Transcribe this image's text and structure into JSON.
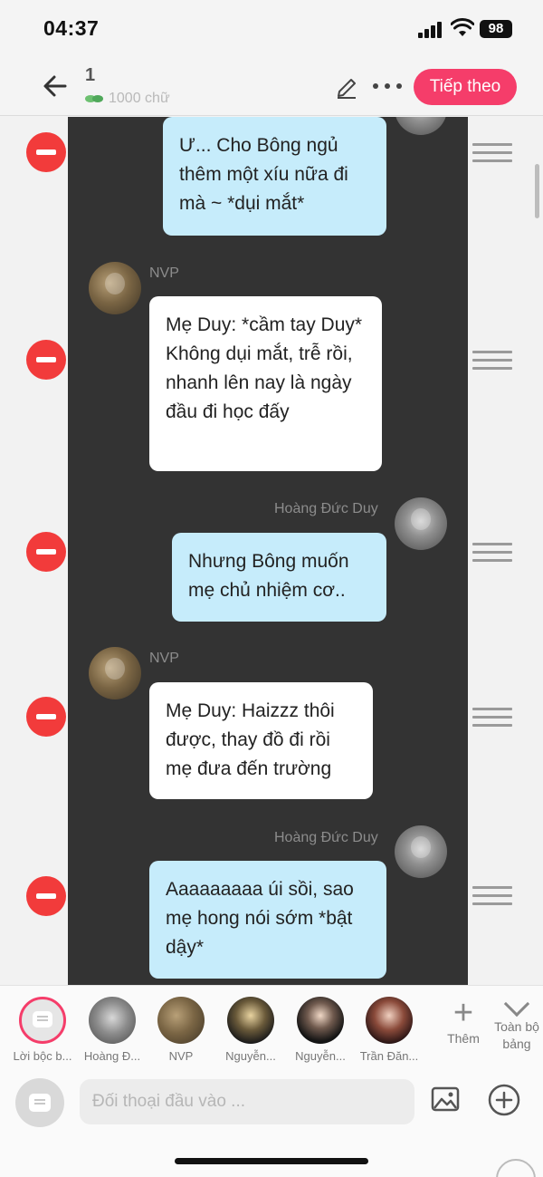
{
  "status_bar": {
    "time": "04:37",
    "battery": "98"
  },
  "header": {
    "title": "1",
    "word_count": "1000 chữ",
    "next_label": "Tiếp theo"
  },
  "messages": [
    {
      "speaker": "",
      "text": "Ư... Cho Bông ngủ thêm một xíu nữa đi mà ~ *dụi mắt*",
      "side": "right",
      "color": "blue"
    },
    {
      "speaker": "NVP",
      "text": "Mẹ Duy: *cầm tay Duy* Không dụi mắt, trễ rồi, nhanh lên nay là ngày đầu đi học đấy",
      "side": "left",
      "color": "white"
    },
    {
      "speaker": "Hoàng Đức Duy",
      "text": "Nhưng Bông muốn mẹ chủ nhiệm cơ..",
      "side": "right",
      "color": "blue"
    },
    {
      "speaker": "NVP",
      "text": "Mẹ Duy: Haizzz thôi được, thay đồ đi rồi mẹ đưa đến trường",
      "side": "left",
      "color": "white"
    },
    {
      "speaker": "Hoàng Đức Duy",
      "text": "Aaaaaaaaa úi sồi, sao mẹ hong nói sớm *bật dậy*",
      "side": "right",
      "color": "blue"
    }
  ],
  "characters": [
    {
      "name": "Lời bộc b..."
    },
    {
      "name": "Hoàng Đ..."
    },
    {
      "name": "NVP"
    },
    {
      "name": "Nguyễn..."
    },
    {
      "name": "Nguyễn..."
    },
    {
      "name": "Trần Đăn..."
    }
  ],
  "add_character_label": "Thêm",
  "all_board_label": "Toàn bộ bảng",
  "input": {
    "placeholder": "Đối thoại đầu vào ..."
  },
  "colors": {
    "accent": "#f53d6a",
    "delete": "#f23b3b",
    "bubble_blue": "#c6ecfb",
    "panel": "#333333"
  }
}
